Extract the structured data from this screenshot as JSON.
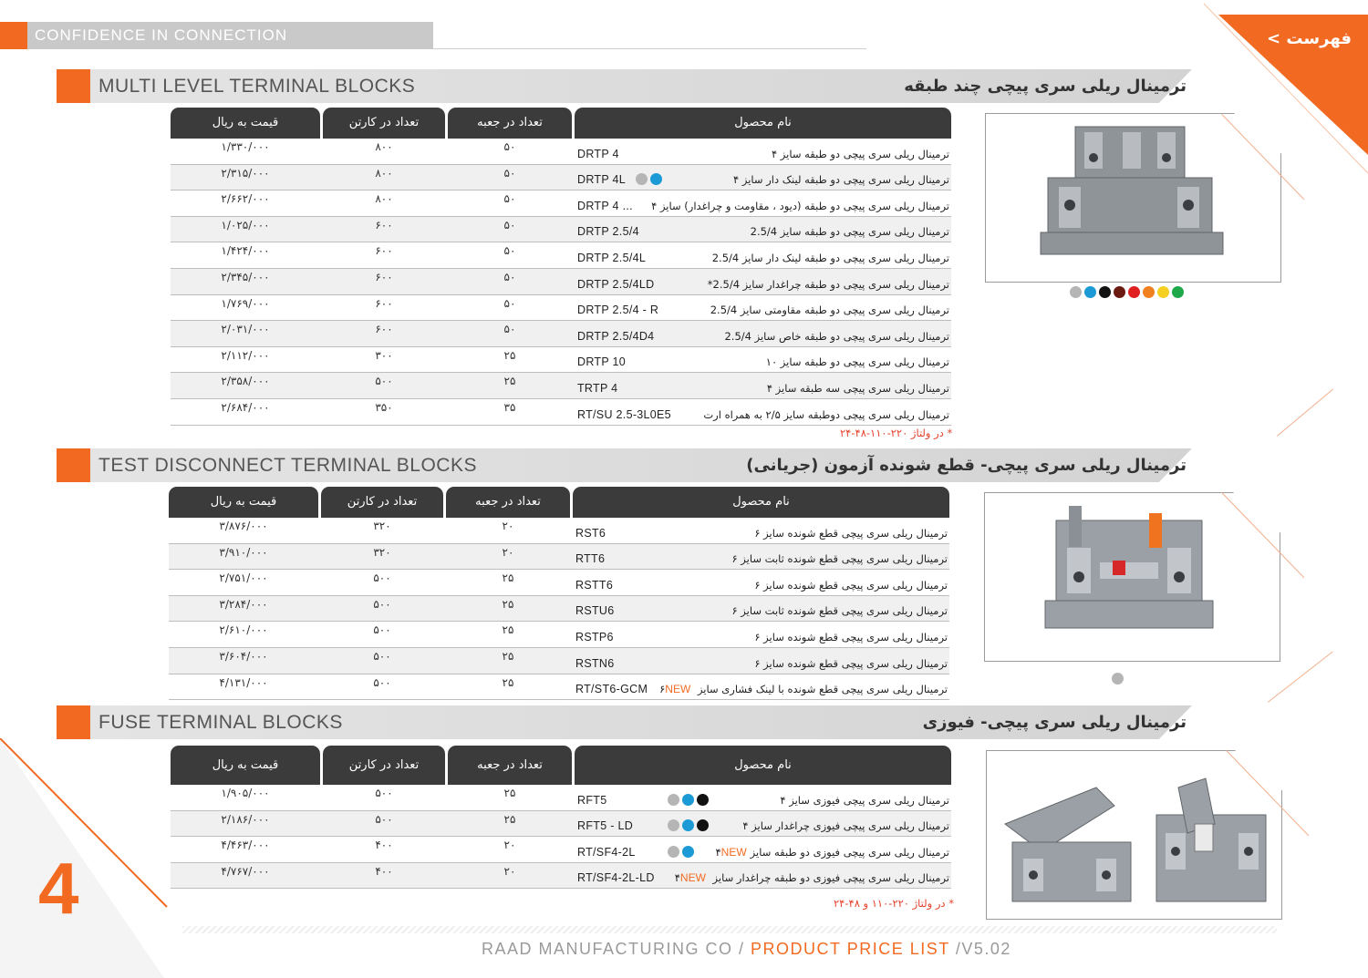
{
  "header": {
    "tagline": "CONFIDENCE IN CONNECTION",
    "index_link": "فهرست >"
  },
  "colors": {
    "accent": "#f26a21",
    "dark_header": "#3b3b3b",
    "note_red": "#e5422b"
  },
  "columns": {
    "price": "قیمت به ریال",
    "carton": "تعداد در کارتن",
    "box": "تعداد در جعبه",
    "name": "نام محصول"
  },
  "sections": [
    {
      "title_en": "MULTI LEVEL TERMINAL BLOCKS",
      "title_fa": "ترمینال ریلی سری پیچی چند طبقه",
      "rows": [
        {
          "price": "۱/۳۳۰/۰۰۰",
          "carton": "۸۰۰",
          "box": "۵۰",
          "code": "DRTP  4",
          "desc": "ترمینال ریلی سری پیچی دو طبقه سایز ۴",
          "dots": []
        },
        {
          "price": "۲/۳۱۵/۰۰۰",
          "carton": "۸۰۰",
          "box": "۵۰",
          "code": "DRTP  4L",
          "desc": "ترمینال ریلی سری پیچی دو طبقه لینک دار سایز ۴",
          "dots": [
            "#b5b5b5",
            "#1c9ad6"
          ]
        },
        {
          "price": "۲/۶۶۲/۰۰۰",
          "carton": "۸۰۰",
          "box": "۵۰",
          "code": "DRTP  4 ...",
          "desc": "ترمینال ریلی سری پیچی دو طبقه (دیود ، مقاومت و چراغدار) سایز ۴",
          "dots": []
        },
        {
          "price": "۱/۰۲۵/۰۰۰",
          "carton": "۶۰۰",
          "box": "۵۰",
          "code": "DRTP  2.5/4",
          "desc": "ترمینال ریلی سری پیچی دو طبقه سایز 2.5/4",
          "dots": []
        },
        {
          "price": "۱/۴۲۴/۰۰۰",
          "carton": "۶۰۰",
          "box": "۵۰",
          "code": "DRTP  2.5/4L",
          "desc": "ترمینال ریلی سری پیچی دو طبقه لینک دار سایز 2.5/4",
          "dots": []
        },
        {
          "price": "۲/۳۴۵/۰۰۰",
          "carton": "۶۰۰",
          "box": "۵۰",
          "code": "DRTP  2.5/4LD",
          "desc": "ترمینال ریلی سری پیچی دو طبقه چراغدار سایز 2.5/4*",
          "dots": []
        },
        {
          "price": "۱/۷۶۹/۰۰۰",
          "carton": "۶۰۰",
          "box": "۵۰",
          "code": "DRTP  2.5/4 - R",
          "desc": "ترمینال ریلی سری پیچی دو طبقه مقاومتی سایز 2.5/4",
          "dots": []
        },
        {
          "price": "۲/۰۳۱/۰۰۰",
          "carton": "۶۰۰",
          "box": "۵۰",
          "code": "DRTP  2.5/4D4",
          "desc": "ترمینال ریلی سری پیچی دو طبقه خاص سایز 2.5/4",
          "dots": []
        },
        {
          "price": "۲/۱۱۲/۰۰۰",
          "carton": "۳۰۰",
          "box": "۲۵",
          "code": "DRTP  10",
          "desc": "ترمینال ریلی سری پیچی دو طبقه سایز ۱۰",
          "dots": []
        },
        {
          "price": "۲/۳۵۸/۰۰۰",
          "carton": "۵۰۰",
          "box": "۲۵",
          "code": "TRTP  4",
          "desc": "ترمینال ریلی سری پیچی سه طبقه سایز ۴",
          "dots": []
        },
        {
          "price": "۲/۶۸۴/۰۰۰",
          "carton": "۳۵۰",
          "box": "۳۵",
          "code": "RT/SU 2.5-3L0E5",
          "desc": "ترمینال ریلی سری پیچی دوطبقه سایز ۲/۵ به همراه ارت",
          "dots": []
        }
      ],
      "note": "* در ولتاژ ۲۲۰-۱۱۰-۴۸-۲۴",
      "swatches": [
        "#b5b5b5",
        "#1c9ad6",
        "#111111",
        "#6b1a12",
        "#e02020",
        "#f08020",
        "#f5d020",
        "#1fa84a"
      ]
    },
    {
      "title_en": "TEST DISCONNECT TERMINAL BLOCKS",
      "title_fa": "ترمینال ریلی سری پیچی- قطع شونده آزمون (جریانی)",
      "rows": [
        {
          "price": "۳/۸۷۶/۰۰۰",
          "carton": "۳۲۰",
          "box": "۲۰",
          "code": "RST6",
          "desc": "ترمینال ریلی سری پیچی قطع شونده سایز ۶",
          "dots": []
        },
        {
          "price": "۳/۹۱۰/۰۰۰",
          "carton": "۳۲۰",
          "box": "۲۰",
          "code": "RTT6",
          "desc": "ترمینال ریلی سری پیچی قطع شونده ثابت سایز ۶",
          "dots": []
        },
        {
          "price": "۲/۷۵۱/۰۰۰",
          "carton": "۵۰۰",
          "box": "۲۵",
          "code": "RSTT6",
          "desc": "ترمینال ریلی سری پیچی قطع شونده سایز ۶",
          "dots": []
        },
        {
          "price": "۳/۲۸۴/۰۰۰",
          "carton": "۵۰۰",
          "box": "۲۵",
          "code": "RSTU6",
          "desc": "ترمینال ریلی سری پیچی قطع شونده ثابت سایز ۶",
          "dots": []
        },
        {
          "price": "۲/۶۱۰/۰۰۰",
          "carton": "۵۰۰",
          "box": "۲۵",
          "code": "RSTP6",
          "desc": "ترمینال ریلی سری پیچی قطع شونده سایز ۶",
          "dots": []
        },
        {
          "price": "۳/۶۰۴/۰۰۰",
          "carton": "۵۰۰",
          "box": "۲۵",
          "code": "RSTN6",
          "desc": "ترمینال ریلی سری پیچی قطع شونده سایز ۶",
          "dots": []
        },
        {
          "price": "۴/۱۳۱/۰۰۰",
          "carton": "۵۰۰",
          "box": "۲۵",
          "code": "RT/ST6-GCM",
          "desc": "ترمینال ریلی سری پیچی قطع شونده با لینک فشاری سایز ۶",
          "new": "NEW",
          "dots": []
        }
      ],
      "swatches": [
        "#b5b5b5"
      ]
    },
    {
      "title_en": "FUSE TERMINAL BLOCKS",
      "title_fa": "ترمینال ریلی سری پیچی- فیوزی",
      "rows": [
        {
          "price": "۱/۹۰۵/۰۰۰",
          "carton": "۵۰۰",
          "box": "۲۵",
          "code": "RFT5",
          "desc": "ترمینال ریلی سری پیچی فیوزی سایز ۴",
          "dots": [
            "#b5b5b5",
            "#1c9ad6",
            "#111111"
          ]
        },
        {
          "price": "۲/۱۸۶/۰۰۰",
          "carton": "۵۰۰",
          "box": "۲۵",
          "code": "RFT5 - LD",
          "desc": "ترمینال ریلی سری پیچی فیوزی چراغدار سایز ۴",
          "dots": [
            "#b5b5b5",
            "#1c9ad6",
            "#111111"
          ]
        },
        {
          "price": "۴/۴۶۳/۰۰۰",
          "carton": "۴۰۰",
          "box": "۲۰",
          "code": "RT/SF4-2L",
          "desc": "ترمینال ریلی سری پیچی فیوزی دو طبقه سایز۴",
          "new": "NEW",
          "dots": [
            "#b5b5b5",
            "#1c9ad6"
          ]
        },
        {
          "price": "۴/۷۶۷/۰۰۰",
          "carton": "۴۰۰",
          "box": "۲۰",
          "code": "RT/SF4-2L-LD",
          "desc": "ترمینال ریلی سری پیچی فیوزی دو طبقه چراغدار سایز ۴",
          "new": "NEW",
          "dots": []
        }
      ],
      "note": "* در ولتاژ ۲۲۰-۱۱۰ و ۴۸-۲۴"
    }
  ],
  "page_number": "4",
  "footer": {
    "company": "RAAD MANUFACTURING CO / ",
    "title": "PRODUCT PRICE LIST",
    "version": " /V5.02"
  }
}
